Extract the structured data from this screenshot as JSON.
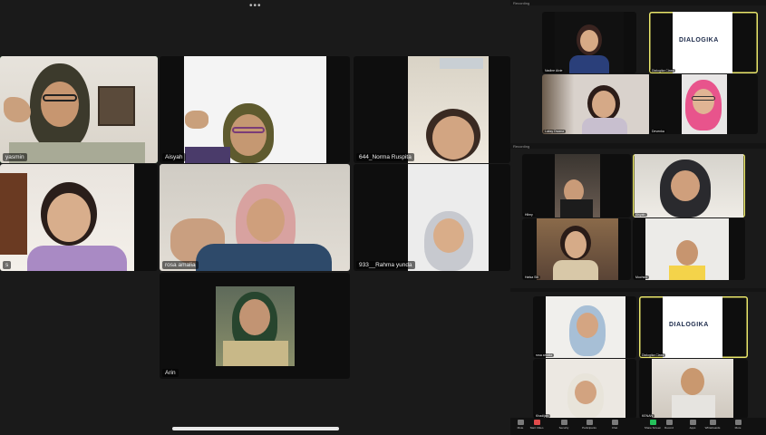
{
  "main_gallery": {
    "tiles": [
      {
        "name": "yasmin",
        "active": true
      },
      {
        "name": "Aisyah"
      },
      {
        "name": "644_Norma Ruspita"
      },
      {
        "name": "s"
      },
      {
        "name": "rosa amalia"
      },
      {
        "name": "933__Rahma yunda"
      },
      {
        "name": "Arin"
      }
    ]
  },
  "mini_panel_top": {
    "header": "Recording",
    "tiles": [
      {
        "name": "Nadine Alvie"
      },
      {
        "name": "Dialogika Class",
        "logo": "DIALOGIKA"
      },
      {
        "name": "Laksy Dwana"
      },
      {
        "name": "Devenka"
      }
    ]
  },
  "mini_panel_middle": {
    "header": "Recording",
    "tiles": [
      {
        "name": "Hilmy"
      },
      {
        "name": "Aisyah"
      },
      {
        "name": "Hafsa Siti"
      },
      {
        "name": "Muchsin"
      }
    ]
  },
  "mini_panel_bottom": {
    "tiles": [
      {
        "name": "rosa amalia"
      },
      {
        "name": "Dialogika Class",
        "logo": "DIALOGIKA"
      },
      {
        "name": "Khadijah"
      },
      {
        "name": "KENAN"
      }
    ]
  },
  "toolbar": {
    "items": [
      "Mute",
      "Start Video",
      "Security",
      "Participants",
      "Chat",
      "Share Screen",
      "Record",
      "Apps",
      "Whiteboards",
      "More"
    ]
  },
  "colors": {
    "active_speaker_border": "#2fd05a",
    "highlight_border": "#e9e66a",
    "background": "#1a1a1a"
  }
}
